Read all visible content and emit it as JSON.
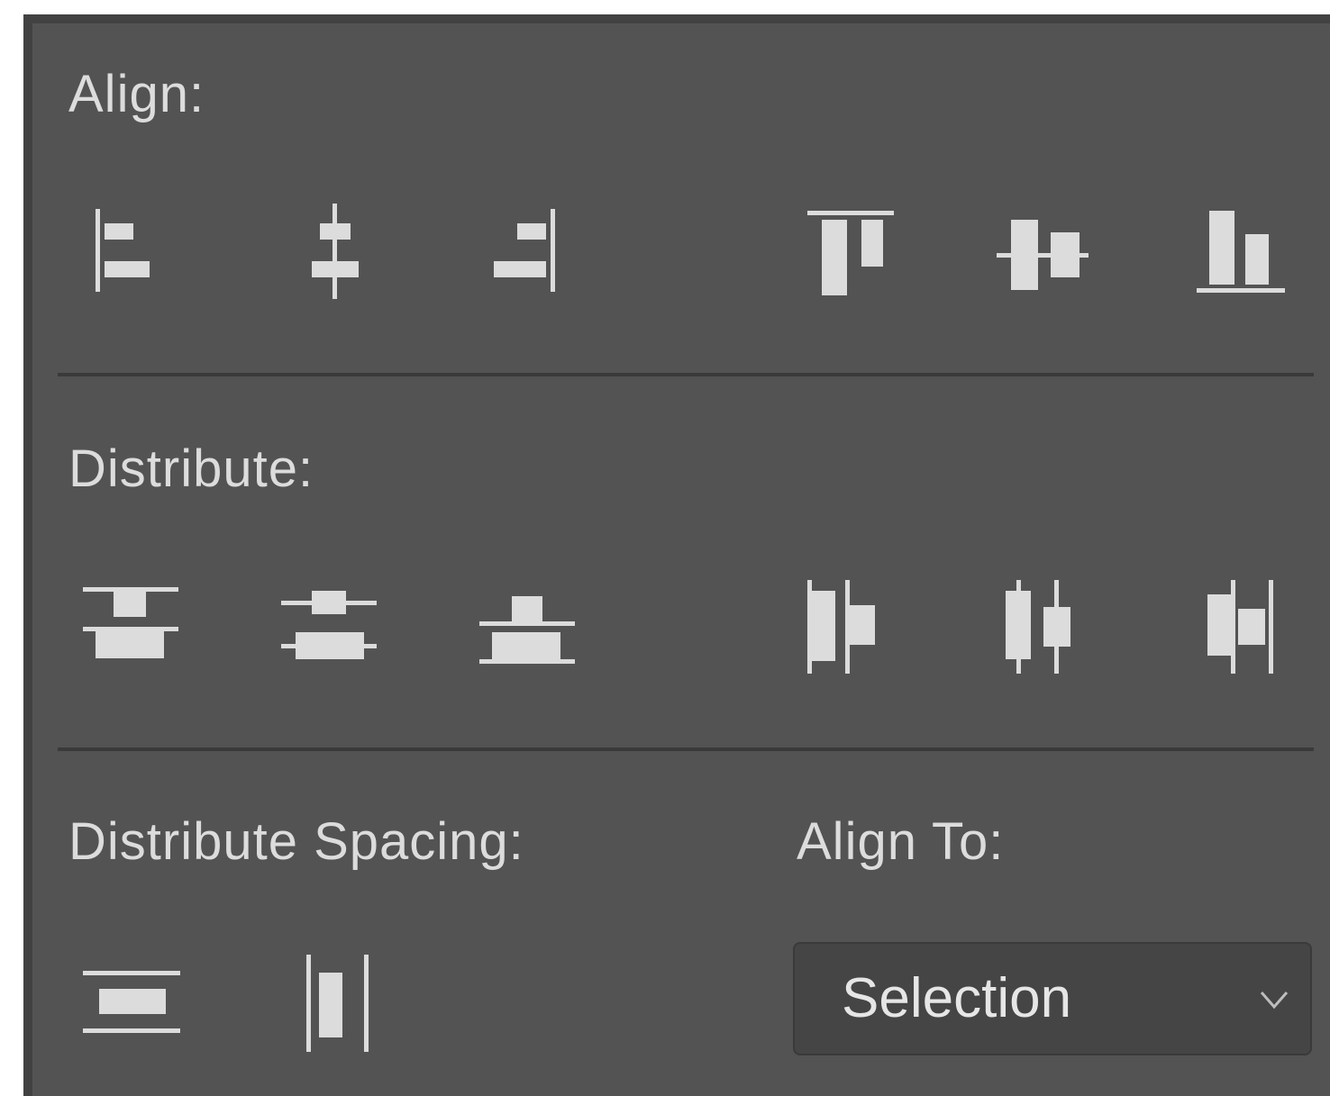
{
  "panel": {
    "align": {
      "heading": "Align:",
      "buttons": [
        {
          "name": "align-left-edges",
          "icon": "align-left-icon"
        },
        {
          "name": "align-horizontal-centers",
          "icon": "align-horizontal-center-icon"
        },
        {
          "name": "align-right-edges",
          "icon": "align-right-icon"
        },
        {
          "name": "align-top-edges",
          "icon": "align-top-icon"
        },
        {
          "name": "align-vertical-centers",
          "icon": "align-vertical-center-icon"
        },
        {
          "name": "align-bottom-edges",
          "icon": "align-bottom-icon"
        }
      ]
    },
    "distribute": {
      "heading": "Distribute:",
      "buttons": [
        {
          "name": "distribute-top-edges",
          "icon": "distribute-top-icon"
        },
        {
          "name": "distribute-vertical-centers",
          "icon": "distribute-vertical-center-icon"
        },
        {
          "name": "distribute-bottom-edges",
          "icon": "distribute-bottom-icon"
        },
        {
          "name": "distribute-left-edges",
          "icon": "distribute-left-icon"
        },
        {
          "name": "distribute-horizontal-centers",
          "icon": "distribute-horizontal-center-icon"
        },
        {
          "name": "distribute-right-edges",
          "icon": "distribute-right-icon"
        }
      ]
    },
    "distribute_spacing": {
      "heading": "Distribute Spacing:",
      "buttons": [
        {
          "name": "distribute-vertical-spacing",
          "icon": "distribute-vertical-spacing-icon"
        },
        {
          "name": "distribute-horizontal-spacing",
          "icon": "distribute-horizontal-spacing-icon"
        }
      ]
    },
    "align_to": {
      "heading": "Align To:",
      "selected": "Selection",
      "icon": "chevron-down-icon"
    },
    "colors": {
      "panel_bg": "#535353",
      "icon_fill": "#dcdcdc",
      "text": "#dcdcdc",
      "divider": "#3a3a3a",
      "dropdown_bg": "#454545"
    }
  }
}
